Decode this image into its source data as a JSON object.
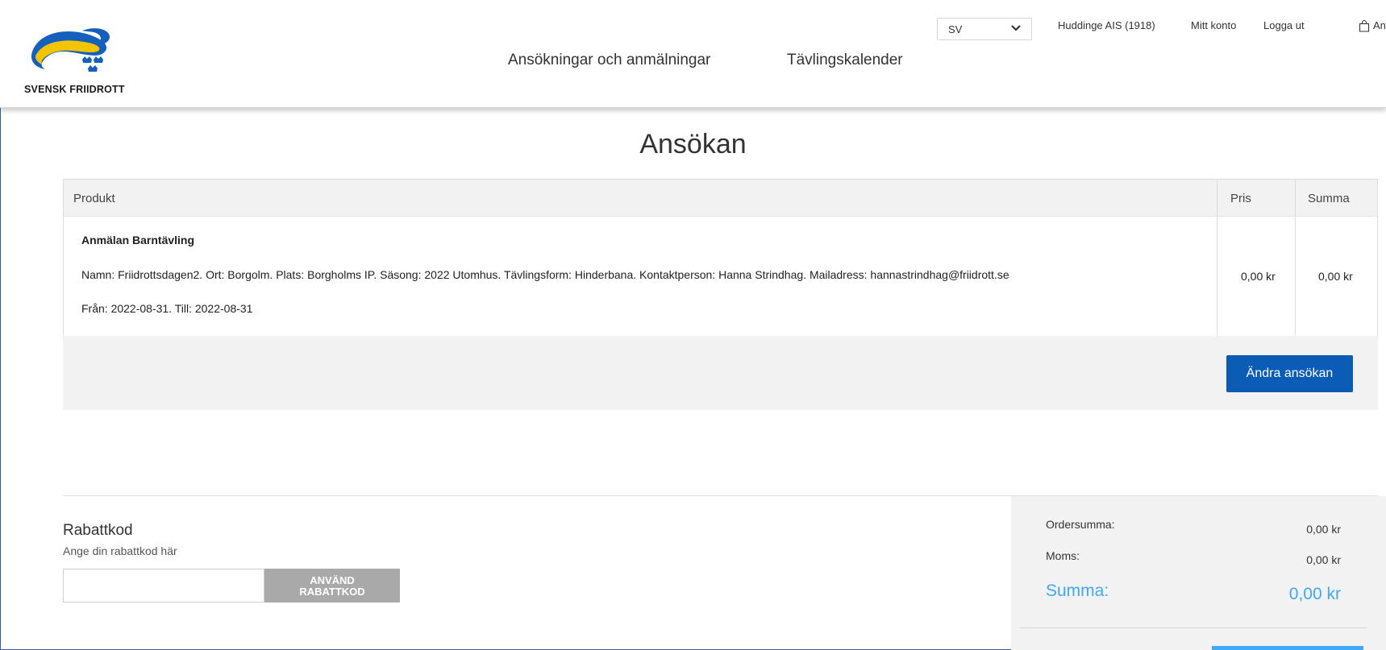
{
  "header": {
    "logo_text": "SVENSK FRIIDROTT",
    "nav": [
      "Ansökningar och anmälningar",
      "Tävlingskalender"
    ],
    "language": "SV",
    "club": "Huddinge AIS (1918)",
    "account": "Mitt konto",
    "logout": "Logga ut",
    "cart_label": "An"
  },
  "page": {
    "title": "Ansökan"
  },
  "table": {
    "columns": [
      "Produkt",
      "Pris",
      "Summa"
    ],
    "row": {
      "name": "Anmälan Barntävling",
      "details": "Namn: Friidrottsdagen2. Ort: Borgolm. Plats: Borgholms IP. Säsong: 2022 Utomhus. Tävlingsform: Hinderbana. Kontaktperson: Hanna Strindhag. Mailadress: hannastrindhag@friidrott.se",
      "dates": "Från: 2022-08-31. Till: 2022-08-31",
      "price": "0,00 kr",
      "sum": "0,00 kr"
    },
    "edit_button": "Ändra ansökan"
  },
  "discount": {
    "title": "Rabattkod",
    "subtitle": "Ange din rabattkod här",
    "input_value": "",
    "button_line1": "ANVÄND",
    "button_line2": "RABATTKOD"
  },
  "summary": {
    "order_label": "Ordersumma:",
    "order_value": "0,00 kr",
    "vat_label": "Moms:",
    "vat_value": "0,00 kr",
    "total_label": "Summa:",
    "total_value": "0,00 kr"
  },
  "colors": {
    "primary_button": "#0b5cb5",
    "accent_blue": "#3fa9f5",
    "logo_yellow": "#f2c500",
    "logo_blue": "#1560bd"
  }
}
